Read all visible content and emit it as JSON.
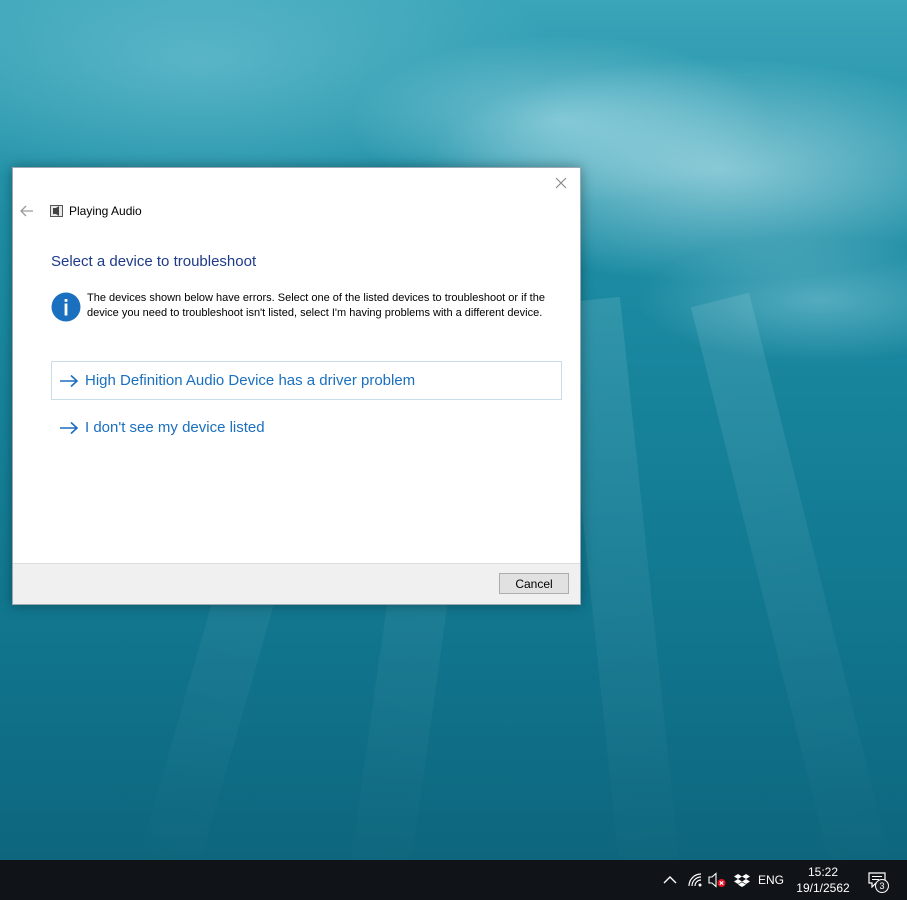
{
  "dialog": {
    "title": "Playing Audio",
    "heading": "Select a device to troubleshoot",
    "info_text": "The devices shown below have errors. Select one of the listed devices to troubleshoot or if the device you need to troubleshoot isn't listed, select I'm having problems with a different device.",
    "options": [
      {
        "label": "High Definition Audio Device has a driver problem"
      },
      {
        "label": "I don't see my device listed"
      }
    ],
    "cancel_label": "Cancel",
    "icons": {
      "close": "close-icon",
      "back": "back-arrow-icon",
      "title": "speaker-icon",
      "info": "info-icon",
      "option": "arrow-right-icon"
    },
    "colors": {
      "heading": "#1e3a8a",
      "link": "#1a6fbf",
      "info_icon": "#1a6fbf"
    }
  },
  "taskbar": {
    "language": "ENG",
    "time": "15:22",
    "date": "19/1/2562",
    "notification_count": "3",
    "icons": {
      "chevron": "chevron-up-icon",
      "network": "wifi-icon",
      "volume": "volume-muted-icon",
      "dropbox": "dropbox-icon",
      "notifications": "action-center-icon"
    }
  }
}
